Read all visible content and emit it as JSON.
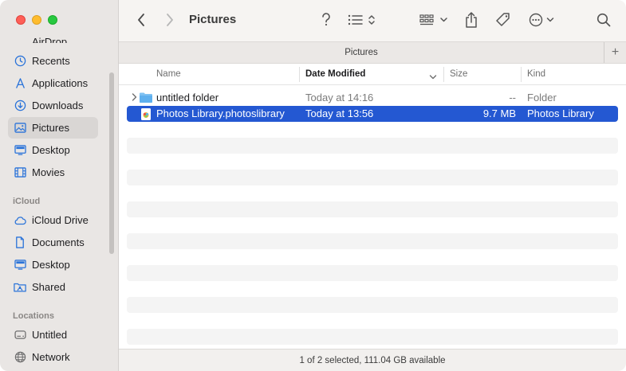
{
  "window": {
    "title": "Pictures"
  },
  "sidebar": {
    "clipped_item": "AirDrop",
    "favorites": [
      {
        "label": "Recents",
        "icon": "clock-icon"
      },
      {
        "label": "Applications",
        "icon": "applications-icon"
      },
      {
        "label": "Downloads",
        "icon": "download-icon"
      },
      {
        "label": "Pictures",
        "icon": "photo-icon",
        "selected": true
      },
      {
        "label": "Desktop",
        "icon": "desktop-icon"
      },
      {
        "label": "Movies",
        "icon": "film-icon"
      }
    ],
    "icloud_heading": "iCloud",
    "icloud": [
      {
        "label": "iCloud Drive",
        "icon": "cloud-icon"
      },
      {
        "label": "Documents",
        "icon": "document-icon"
      },
      {
        "label": "Desktop",
        "icon": "desktop-icon"
      },
      {
        "label": "Shared",
        "icon": "shared-folder-icon"
      }
    ],
    "locations_heading": "Locations",
    "locations": [
      {
        "label": "Untitled",
        "icon": "disk-icon"
      },
      {
        "label": "Network",
        "icon": "globe-icon"
      }
    ]
  },
  "tabbar": {
    "tab_label": "Pictures",
    "new_tab": "+"
  },
  "columns": {
    "name": "Name",
    "date_modified": "Date Modified",
    "size": "Size",
    "kind": "Kind"
  },
  "files": [
    {
      "name": "untitled folder",
      "date": "Today at 14:16",
      "size": "--",
      "kind": "Folder",
      "selected": false
    },
    {
      "name": "Photos Library.photoslibrary",
      "date": "Today at 13:56",
      "size": "9.7 MB",
      "kind": "Photos Library",
      "selected": true
    }
  ],
  "status": {
    "text": "1 of 2 selected, 111.04 GB available"
  },
  "colors": {
    "selection": "#2458d2",
    "accent": "#2a73d9",
    "sidebar_bg": "#e9e6e4"
  }
}
